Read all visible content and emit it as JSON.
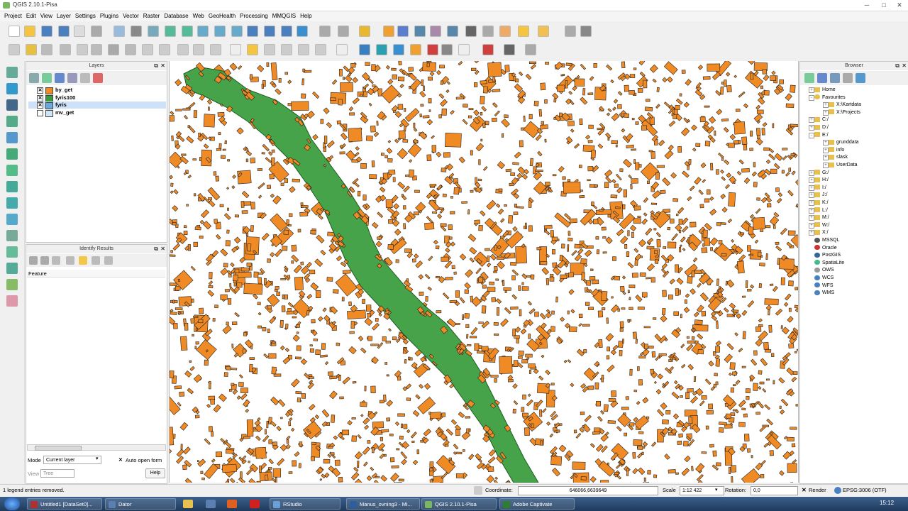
{
  "window": {
    "title": "QGIS 2.10.1-Pisa",
    "minimize": "─",
    "maximize": "□",
    "close": "✕"
  },
  "menu": [
    "Project",
    "Edit",
    "View",
    "Layer",
    "Settings",
    "Plugins",
    "Vector",
    "Raster",
    "Database",
    "Web",
    "GeoHealth",
    "Processing",
    "MMQGIS",
    "Help"
  ],
  "layers_panel": {
    "title": "Layers",
    "items": [
      {
        "name": "by_get",
        "checked": "✕",
        "color": "#f08a24"
      },
      {
        "name": "fyris100",
        "checked": "✕",
        "color": "#3a9a3a"
      },
      {
        "name": "fyris",
        "checked": "✕",
        "color": "#6aa8e0"
      },
      {
        "name": "mv_get",
        "checked": "",
        "color": "#cfe4f7"
      }
    ]
  },
  "identify_panel": {
    "title": "Identify Results",
    "column": "Feature",
    "mode_label": "Mode",
    "mode_value": "Current layer",
    "auto_open_label": "Auto open form",
    "auto_open_check": "✕",
    "view_label": "View",
    "view_value": "Tree",
    "help_button": "Help"
  },
  "browser_panel": {
    "title": "Browser",
    "items": [
      {
        "label": "Home",
        "icon": "folder-icon",
        "expander": "+"
      },
      {
        "label": "Favourites",
        "icon": "favourites-icon",
        "expander": "-"
      },
      {
        "label": "X:\\Kartdata",
        "icon": "folder-icon",
        "expander": "+"
      },
      {
        "label": "X:\\Projects",
        "icon": "folder-icon",
        "expander": "+"
      },
      {
        "label": "C:/",
        "icon": "folder-icon",
        "expander": "+"
      },
      {
        "label": "D:/",
        "icon": "folder-icon",
        "expander": "+"
      },
      {
        "label": "E:/",
        "icon": "folder-icon",
        "expander": "-"
      },
      {
        "label": "grunddata",
        "icon": "folder-icon",
        "expander": "+"
      },
      {
        "label": "info",
        "icon": "folder-icon",
        "expander": "+"
      },
      {
        "label": "slask",
        "icon": "folder-icon",
        "expander": "+"
      },
      {
        "label": "UserData",
        "icon": "folder-icon",
        "expander": "+"
      },
      {
        "label": "G:/",
        "icon": "folder-icon",
        "expander": "+"
      },
      {
        "label": "H:/",
        "icon": "folder-icon",
        "expander": "+"
      },
      {
        "label": "I:/",
        "icon": "folder-icon",
        "expander": "+"
      },
      {
        "label": "J:/",
        "icon": "folder-icon",
        "expander": "+"
      },
      {
        "label": "K:/",
        "icon": "folder-icon",
        "expander": "+"
      },
      {
        "label": "L:/",
        "icon": "folder-icon",
        "expander": "+"
      },
      {
        "label": "M:/",
        "icon": "folder-icon",
        "expander": "+"
      },
      {
        "label": "W:/",
        "icon": "folder-icon",
        "expander": "+"
      },
      {
        "label": "X:/",
        "icon": "folder-icon",
        "expander": "+"
      },
      {
        "label": "MSSQL",
        "icon": "mssql-icon",
        "expander": ""
      },
      {
        "label": "Oracle",
        "icon": "oracle-icon",
        "expander": ""
      },
      {
        "label": "PostGIS",
        "icon": "postgis-icon",
        "expander": ""
      },
      {
        "label": "SpatiaLite",
        "icon": "spatialite-icon",
        "expander": ""
      },
      {
        "label": "OWS",
        "icon": "ows-icon",
        "expander": ""
      },
      {
        "label": "WCS",
        "icon": "wcs-icon",
        "expander": ""
      },
      {
        "label": "WFS",
        "icon": "wfs-icon",
        "expander": ""
      },
      {
        "label": "WMS",
        "icon": "wms-icon",
        "expander": ""
      }
    ]
  },
  "statusbar": {
    "message": "1 legend entries removed.",
    "coordinate_label": "Coordinate:",
    "coordinate_value": "646066,6639649",
    "scale_label": "Scale",
    "scale_value": "1:12 422",
    "rotation_label": "Rotation:",
    "rotation_value": "0,0",
    "render_label": "Render",
    "render_check": "✕",
    "crs": "EPSG:3006 (OTF)"
  },
  "taskbar": {
    "tasks": [
      {
        "label": "Untitled1 [DataSet0]...",
        "color": "#b03030"
      },
      {
        "label": "Dator",
        "color": "#5a7fb0"
      },
      {
        "label": "RStudio",
        "color": "#6aa0d8"
      },
      {
        "label": "Manus_ovning3 - Mi...",
        "color": "#2d5f9e"
      },
      {
        "label": "QGIS 2.10.1-Pisa",
        "color": "#7bb661"
      },
      {
        "label": "Adobe Captivate",
        "color": "#2e7d32"
      }
    ],
    "clock": "15:12"
  },
  "colors": {
    "buildings": "#f08a24",
    "river": "#46a34a",
    "map_bg": "#ffffff"
  }
}
